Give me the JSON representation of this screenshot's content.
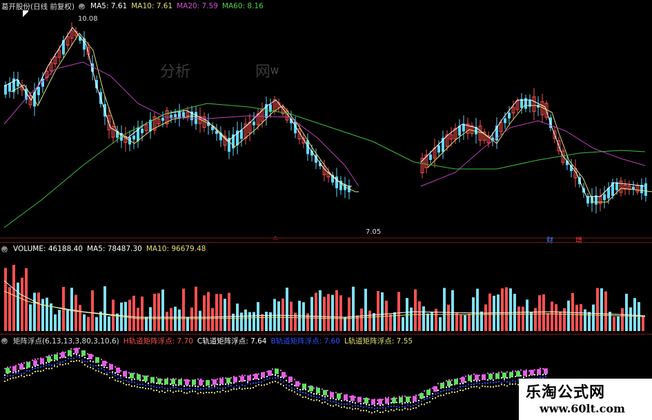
{
  "price_panel": {
    "stock_name": "葛开股份",
    "period_label": "(日线 前复权)",
    "ma5": "MA5: 7.61",
    "ma10": "MA10: 7.61",
    "ma20": "MA20: 7.59",
    "ma60": "MA60: 8.16",
    "high_marker": "10.08",
    "low_marker": "7.05",
    "event_mark_1": "⚠",
    "event_mark_2": "财",
    "event_mark_3": "增",
    "bg_text_1": "分析",
    "bg_text_2": "网",
    "bg_text_3": "W",
    "colors": {
      "ma5": "#ffffff",
      "ma10": "#e8e070",
      "ma20": "#c040c0",
      "ma60": "#40c040",
      "up": "#ff5050",
      "down": "#5fd8ff"
    }
  },
  "volume_panel": {
    "label": "VOLUME: 46188.40",
    "ma5": "MA5: 78487.30",
    "ma10": "MA10: 96679.48"
  },
  "indicator_panel": {
    "name": "矩阵浮点(6,13,13,3,80,3,10,6)",
    "h_line": "H轨道矩阵浮点: 7.70",
    "c_line": "C轨道矩阵浮点: 7.64",
    "b_line": "B轨道矩阵浮点: 7.60",
    "l_line": "L轨道矩阵浮点: 7.55"
  },
  "watermark": {
    "title": "乐淘公式网",
    "url": "www.60lt.com"
  }
}
